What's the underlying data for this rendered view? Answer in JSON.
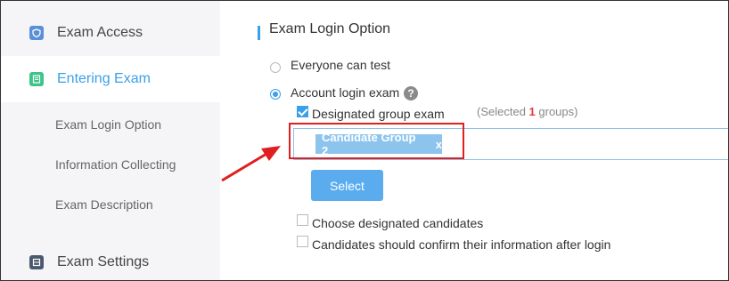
{
  "sidebar": {
    "items": [
      {
        "label": "Exam Access",
        "icon": "shield-icon"
      },
      {
        "label": "Entering Exam",
        "icon": "document-icon"
      },
      {
        "label": "Exam Settings",
        "icon": "settings-icon"
      }
    ],
    "subitems": [
      "Exam Login Option",
      "Information Collecting",
      "Exam Description"
    ]
  },
  "main": {
    "section_title": "Exam Login Option",
    "option_everyone": "Everyone can test",
    "option_account": "Account login exam",
    "help_symbol": "?",
    "designated_group": "Designated group exam",
    "selected_prefix": "(Selected ",
    "selected_count": "1",
    "selected_suffix": " groups)",
    "group_tag": "Candidate Group 2",
    "tag_remove": "x",
    "select_button": "Select",
    "choose_candidates": "Choose designated candidates",
    "confirm_info": "Candidates should confirm their information after login"
  },
  "colors": {
    "accent": "#3aa0e8",
    "highlight": "#e02020",
    "tag": "#8cc4ee",
    "button": "#5aacef"
  }
}
